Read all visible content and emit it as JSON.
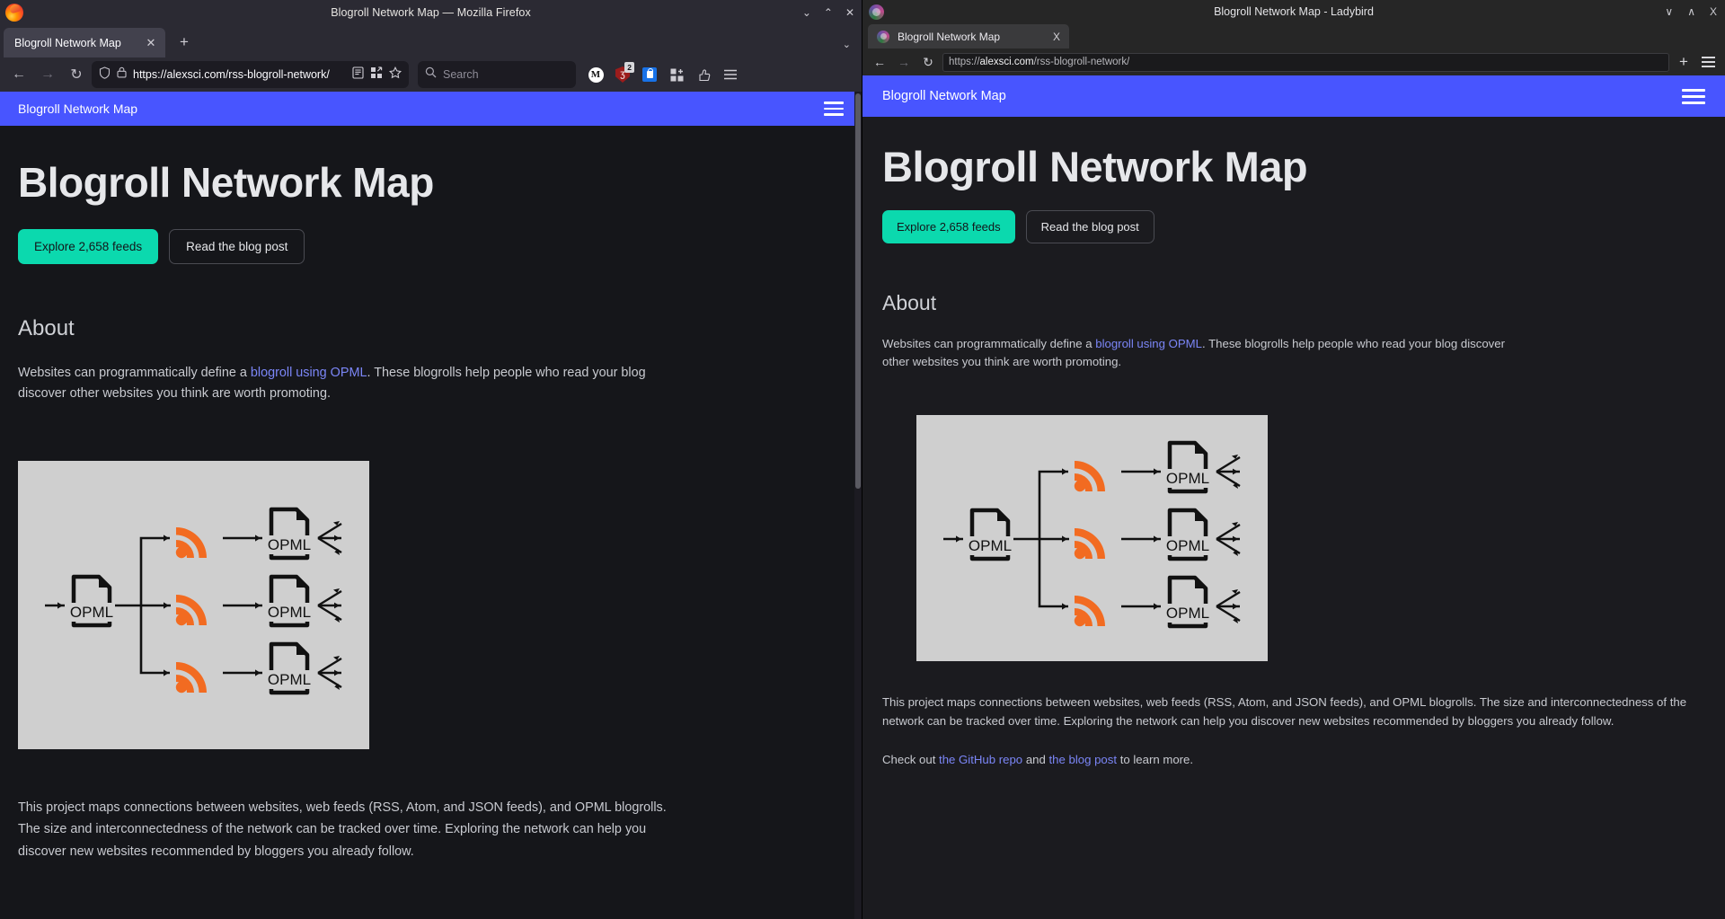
{
  "firefox": {
    "window_title": "Blogroll Network Map — Mozilla Firefox",
    "tab": {
      "label": "Blogroll Network Map",
      "close": "✕"
    },
    "new_tab": "+",
    "tab_list_chevron": "⌄",
    "window_controls": {
      "minimize": "⌄",
      "maximize": "⌃",
      "close": "✕"
    },
    "nav": {
      "back": "←",
      "forward": "→",
      "reload": "↻"
    },
    "url": {
      "scheme": "https://",
      "host": "alexsci.com",
      "path": "/rss-blogroll-network/",
      "full": "https://alexsci.com/rss-blogroll-network/"
    },
    "search": {
      "placeholder": "Search"
    },
    "extensions": [
      {
        "name": "metamask-extension-icon",
        "glyph": "M"
      },
      {
        "name": "ublock-origin-icon",
        "glyph": "Ʒ",
        "badge": "2"
      },
      {
        "name": "bitwarden-icon",
        "glyph": ""
      },
      {
        "name": "extensions-icon",
        "glyph": ""
      },
      {
        "name": "pocket-icon",
        "glyph": ""
      }
    ],
    "app_menu": "☰"
  },
  "ladybird": {
    "window_title": "Blogroll Network Map - Ladybird",
    "tab": {
      "label": "Blogroll Network Map",
      "close": "X"
    },
    "window_controls": {
      "minimize": "∨",
      "maximize": "∧",
      "close": "X"
    },
    "nav": {
      "back": "←",
      "forward": "→",
      "reload": "↻"
    },
    "url": {
      "scheme": "https://",
      "host": "alexsci.com",
      "path": "/rss-blogroll-network/",
      "full": "https://alexsci.com/rss-blogroll-network/"
    },
    "new_tab": "+",
    "app_menu": "☰"
  },
  "page": {
    "brand": "Blogroll Network Map",
    "nav_toggle": "hamburger-menu",
    "h1": "Blogroll Network Map",
    "buttons": {
      "primary": "Explore 2,658 feeds",
      "secondary": "Read the blog post"
    },
    "about_heading": "About",
    "about_paragraph": {
      "before_link": "Websites can programmatically define a ",
      "link": "blogroll using OPML",
      "after_link": ". These blogrolls help people who read your blog discover other websites you think are worth promoting."
    },
    "diagram": {
      "alt": "opml-blogroll-network-diagram",
      "node_label": "OPML",
      "source_count": 1,
      "feed_count": 3,
      "target_count": 3,
      "background": "#cfcfcf",
      "feed_color": "#f26b21",
      "stroke_color": "#111111"
    },
    "project_paragraph": "This project maps connections between websites, web feeds (RSS, Atom, and JSON feeds), and OPML blogrolls. The size and interconnectedness of the network can be tracked over time. Exploring the network can help you discover new websites recommended by bloggers you already follow.",
    "checkout_paragraph": {
      "before": "Check out ",
      "link1": "the GitHub repo",
      "middle": " and ",
      "link2": "the blog post",
      "after": " to learn more."
    },
    "feed_count_value": "2,658",
    "colors": {
      "nav_blue": "#4855ff",
      "accent_teal": "#0bd9ae",
      "page_bg_firefox": "#15161a",
      "page_bg_ladybird": "#1b1b1f",
      "link_purple": "#7b86f7"
    }
  }
}
